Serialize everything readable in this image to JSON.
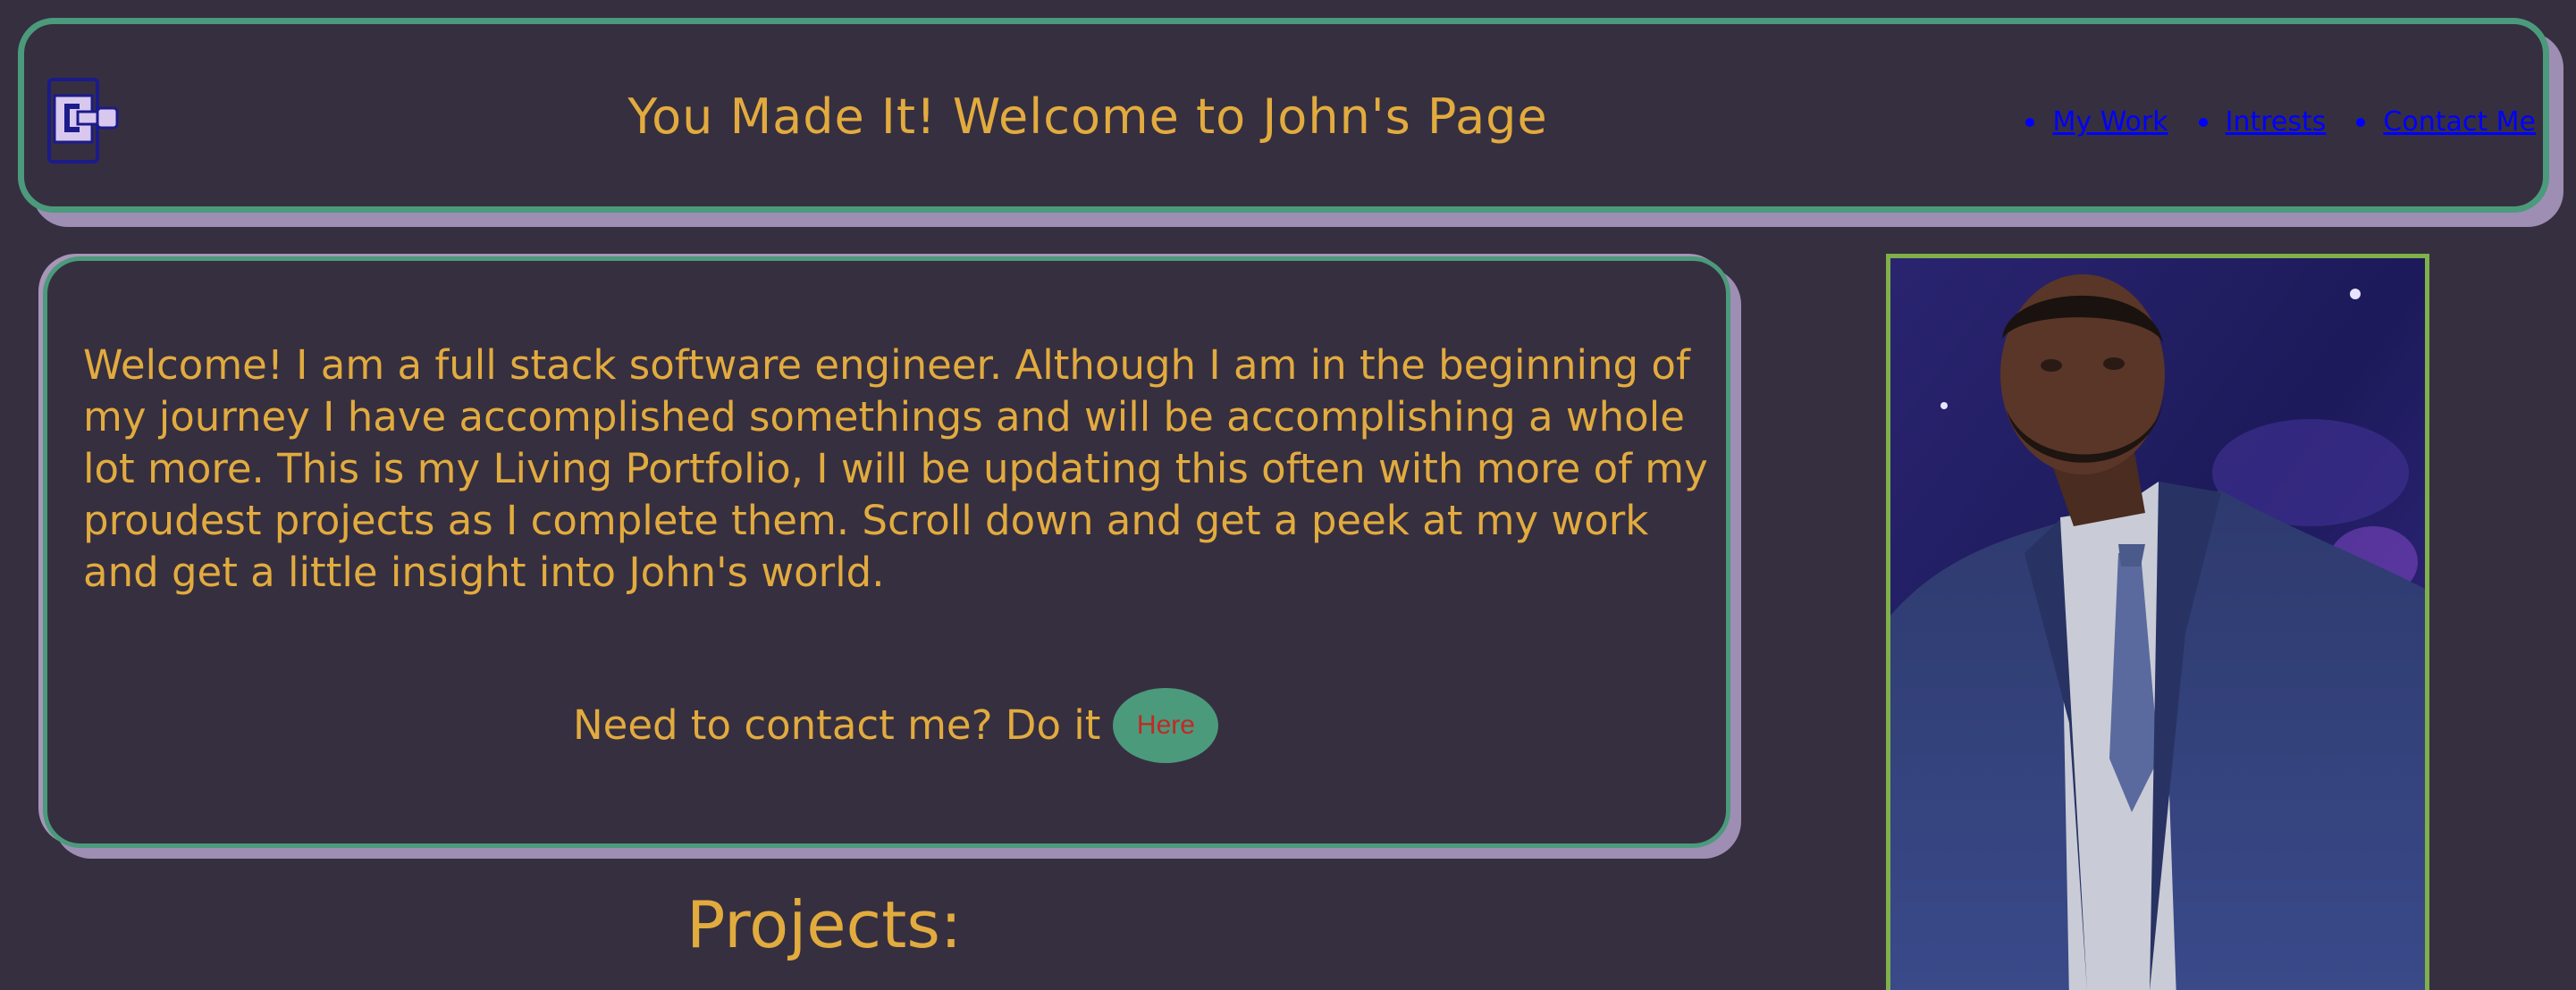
{
  "header": {
    "title": "You Made It! Welcome to John's Page",
    "logo_icon": "phone-plug-logo-icon",
    "nav": [
      {
        "label": "My Work"
      },
      {
        "label": "Intrests"
      },
      {
        "label": "Contact Me"
      }
    ]
  },
  "intro": {
    "text": "Welcome! I am a full stack software engineer. Although I am in the beginning of my journey I have accomplished somethings and will be accomplishing a whole lot more. This is my Living Portfolio, I will be updating this often with more of my proudest projects as I complete them. Scroll down and get a peek at my work and get a little insight into John's world.",
    "contact_prompt": "Need to contact me? Do it",
    "contact_button": "Here"
  },
  "projects": {
    "heading": "Projects:"
  },
  "colors": {
    "background": "#362f40",
    "accent_text": "#e2ab3e",
    "border_green": "#4b9a7c",
    "shadow_purple": "#9e8eb3",
    "link_blue": "#0000ff",
    "button_text_red": "#c02a25",
    "photo_border": "#7fb04a"
  }
}
